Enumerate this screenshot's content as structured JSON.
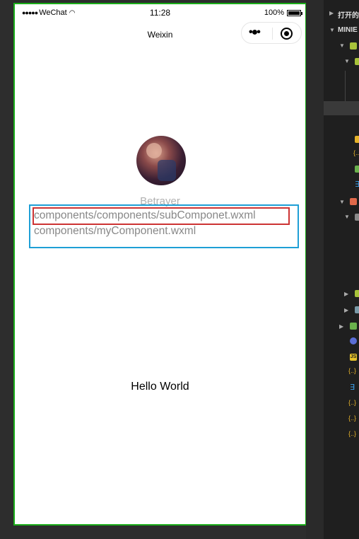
{
  "status_bar": {
    "carrier": "WeChat",
    "time": "11:28",
    "battery": "100%"
  },
  "nav": {
    "title": "Weixin",
    "more_icon": "more-dots-icon",
    "close_icon": "record-close-icon"
  },
  "user": {
    "nickname": "Betrayer",
    "avatar_icon": "user-avatar"
  },
  "paths": [
    "components/components/subComponet.wxml",
    "components/myComponent.wxml"
  ],
  "content": {
    "hello": "Hello World"
  },
  "editor": {
    "section_open": "打开的",
    "project": "MINIE"
  },
  "colors": {
    "sim_border": "#1aad19",
    "blue_highlight": "#1e9fd6",
    "red_highlight": "#cc3333",
    "panel_bg": "#1f1f1f"
  }
}
